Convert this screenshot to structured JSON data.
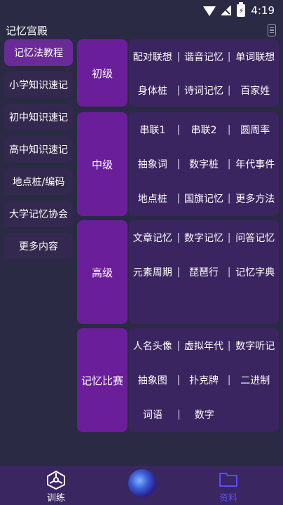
{
  "status": {
    "time": "4:19",
    "battery_glyph": "⚡"
  },
  "app": {
    "title": "记忆宫殿"
  },
  "sidebar": {
    "items": [
      {
        "label": "记忆法教程",
        "active": true
      },
      {
        "label": "小学知识速记"
      },
      {
        "label": "初中知识速记"
      },
      {
        "label": "高中知识速记"
      },
      {
        "label": "地点桩/编码"
      },
      {
        "label": "大学记忆协会"
      },
      {
        "label": "更多内容"
      }
    ]
  },
  "sections": [
    {
      "label": "初级",
      "rows": [
        [
          "配对联想",
          "谐音记忆",
          "单词联想"
        ],
        [
          "身体桩",
          "诗词记忆",
          "百家姓"
        ]
      ]
    },
    {
      "label": "中级",
      "rows": [
        [
          "串联1",
          "串联2",
          "圆周率"
        ],
        [
          "抽象词",
          "数字桩",
          "年代事件"
        ],
        [
          "地点桩",
          "国旗记忆",
          "更多方法"
        ]
      ]
    },
    {
      "label": "高级",
      "rows": [
        [
          "文章记忆",
          "数字记忆",
          "问答记忆"
        ],
        [
          "元素周期",
          "琵琶行",
          "记忆字典"
        ]
      ]
    },
    {
      "label": "记忆比赛",
      "rows": [
        [
          "人名头像",
          "虚拟年代",
          "数字听记"
        ],
        [
          "抽象图",
          "扑克牌",
          "二进制"
        ],
        [
          "词语",
          "数字"
        ]
      ]
    }
  ],
  "bottom_nav": {
    "items": [
      {
        "label": "训练",
        "icon": "training-icon",
        "color": "#ffffff"
      },
      {
        "label": "资料",
        "icon": "folder-icon",
        "color": "#5a4cff",
        "active": true
      }
    ]
  },
  "colors": {
    "background": "#2a2a44",
    "sidebar_item": "#33294e",
    "sidebar_active": "#6a2a98",
    "section_label": "#6a1e9a",
    "section_panel": "#3b2560",
    "bottom_bar": "#3a2660",
    "accent": "#5a4cff"
  }
}
